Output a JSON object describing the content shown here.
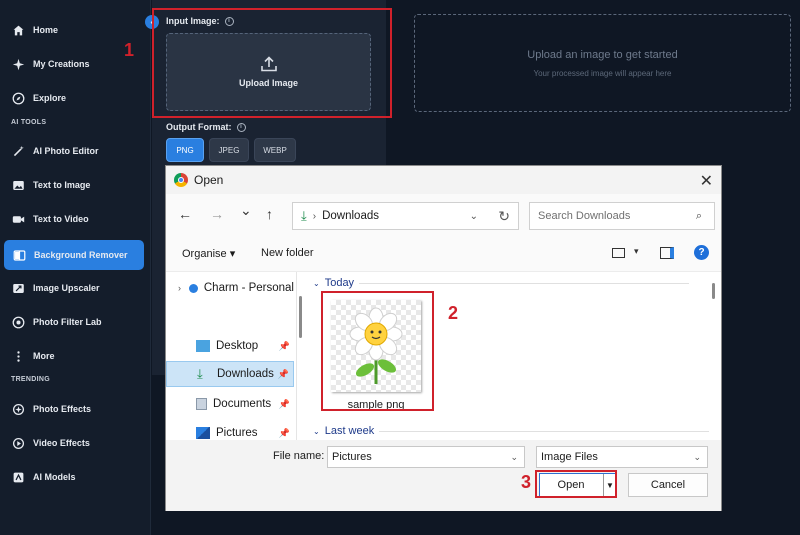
{
  "sidebar": {
    "items": [
      {
        "label": "Home",
        "icon": "home-icon"
      },
      {
        "label": "My Creations",
        "icon": "sparkle-icon"
      },
      {
        "label": "Explore",
        "icon": "compass-icon"
      }
    ],
    "ai_tools_label": "AI TOOLS",
    "tools": [
      {
        "label": "AI Photo Editor",
        "icon": "wand-icon"
      },
      {
        "label": "Text to Image",
        "icon": "image-icon"
      },
      {
        "label": "Text to Video",
        "icon": "video-icon"
      },
      {
        "label": "Background Remover",
        "icon": "split-view-icon"
      },
      {
        "label": "Image Upscaler",
        "icon": "upscale-icon"
      },
      {
        "label": "Photo Filter Lab",
        "icon": "filter-icon"
      },
      {
        "label": "More",
        "icon": "more-vertical-icon"
      }
    ],
    "trending_label": "TRENDING",
    "trending": [
      {
        "label": "Photo Effects",
        "icon": "effects-icon"
      },
      {
        "label": "Video Effects",
        "icon": "video-effects-icon"
      },
      {
        "label": "AI Models",
        "icon": "ai-models-icon"
      }
    ],
    "active_item": "Background Remover",
    "accent_color": "#2a7fe0"
  },
  "input_panel": {
    "input_label": "Input Image:",
    "upload_label": "Upload Image",
    "output_label": "Output Format:",
    "formats": [
      "PNG",
      "JPEG",
      "WEBP"
    ],
    "selected_format": "PNG"
  },
  "result_area": {
    "title": "Upload an image to get started",
    "subtitle": "Your processed image will appear here"
  },
  "annotations": {
    "step1": "1",
    "step2": "2",
    "step3": "3",
    "color": "#d0212b"
  },
  "dialog": {
    "title": "Open",
    "close": "✕",
    "nav": {
      "back": "←",
      "forward": "→",
      "dropdown": "⌄",
      "up": "↑"
    },
    "address": {
      "location": "Downloads"
    },
    "search_placeholder": "Search Downloads",
    "commands": {
      "organise": "Organise ▾",
      "new_folder": "New folder"
    },
    "tree": [
      {
        "label": "Charm - Personal",
        "icon": "cloud-icon"
      },
      {
        "label": "Desktop",
        "icon": "desktop-icon"
      },
      {
        "label": "Downloads",
        "icon": "download-icon"
      },
      {
        "label": "Documents",
        "icon": "document-icon"
      },
      {
        "label": "Pictures",
        "icon": "pictures-icon"
      }
    ],
    "selected_tree_item": "Downloads",
    "groups": {
      "today": "Today",
      "last_week": "Last week"
    },
    "file": {
      "name": "sample png"
    },
    "file_name_label": "File name:",
    "file_name_value": "Pictures",
    "file_type": "Image Files",
    "open_button": "Open",
    "cancel_button": "Cancel"
  }
}
